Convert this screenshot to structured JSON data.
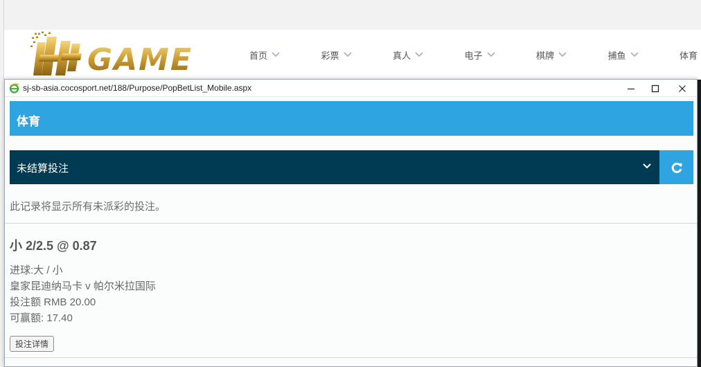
{
  "site": {
    "logo_text": "HH GAME",
    "nav": [
      {
        "label": "首页"
      },
      {
        "label": "彩票"
      },
      {
        "label": "真人"
      },
      {
        "label": "电子"
      },
      {
        "label": "棋牌"
      },
      {
        "label": "捕鱼"
      },
      {
        "label": "体育"
      }
    ]
  },
  "popup": {
    "url": "sj-sb-asia.cocosport.net/188/Purpose/PopBetList_Mobile.aspx",
    "header_title": "体育",
    "filter_selected": "未结算投注",
    "notice": "此记录将显示所有未派彩的投注。",
    "bet": {
      "title": "小 2/2.5 @ 0.87",
      "market": "进球:大 / 小",
      "match": "皇家昆迪纳马卡 v 帕尔米拉国际",
      "stake": "投注额 RMB 20.00",
      "win": "可赢额: 17.40",
      "detail_button": "投注详情"
    }
  },
  "colors": {
    "header_blue": "#2ea4e0",
    "filter_navy": "#013a53",
    "logo_gold": "#c9992f"
  },
  "icons": {
    "browser": "ie-icon",
    "refresh": "refresh-icon",
    "chevron": "chevron-down-icon"
  }
}
